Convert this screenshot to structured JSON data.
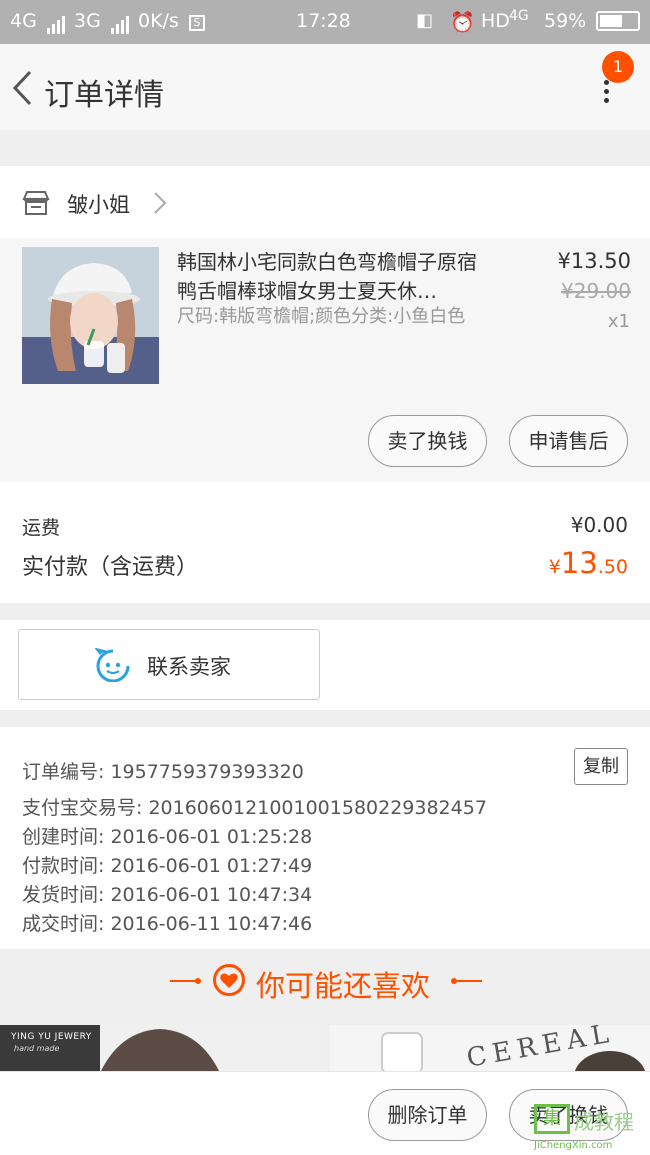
{
  "status_bar": {
    "net1": "4G",
    "net2": "3G",
    "speed": "0K/s",
    "speed_badge": "S",
    "time": "17:28",
    "hd": "HD",
    "net3": "4G",
    "battery": "59%"
  },
  "nav": {
    "back_icon": "chevron-left-icon",
    "title": "订单详情",
    "more_icon": "more-vertical-icon",
    "badge_count": "1"
  },
  "shop": {
    "icon": "store-icon",
    "name": "皱小姐"
  },
  "item": {
    "title": "韩国林小宅同款白色弯檐帽子原宿鸭舌帽棒球帽女男士夏天休…",
    "sku": "尺码:韩版弯檐帽;颜色分类:小鱼白色",
    "price": "¥13.50",
    "original_price": "¥29.00",
    "quantity": "x1",
    "btn_resell": "卖了换钱",
    "btn_after_sale": "申请售后"
  },
  "fees": {
    "shipping_label": "运费",
    "shipping_value": "¥0.00",
    "paid_label": "实付款（含运费）",
    "paid_currency": "¥",
    "paid_integer": "13",
    "paid_decimal": ".50"
  },
  "contact": {
    "label": "联系卖家",
    "icon": "chat-face-icon"
  },
  "order_info": {
    "order_no": "订单编号: 1957759379393320",
    "copy_label": "复制",
    "alipay_no": "支付宝交易号: 2016060121001001580229382457",
    "created": "创建时间: 2016-06-01 01:25:28",
    "paid": "付款时间: 2016-06-01 01:27:49",
    "shipped": "发货时间: 2016-06-01 10:47:34",
    "completed": "成交时间: 2016-06-11 10:47:46"
  },
  "recommend": {
    "title": "你可能还喜欢",
    "icon": "heart-circle-icon",
    "products": [
      {
        "brand": "YING YU JEWERY",
        "sub": "hand made"
      },
      {
        "brand": "CEREAL"
      }
    ]
  },
  "bottom_bar": {
    "delete_label": "删除订单",
    "resell_label": "卖了换钱"
  },
  "watermark": {
    "logo_char": "集",
    "text": "成教程",
    "url": "JiChengXin.com"
  },
  "colors": {
    "accent": "#ff5000",
    "status_bar": "#b1b1b1"
  }
}
